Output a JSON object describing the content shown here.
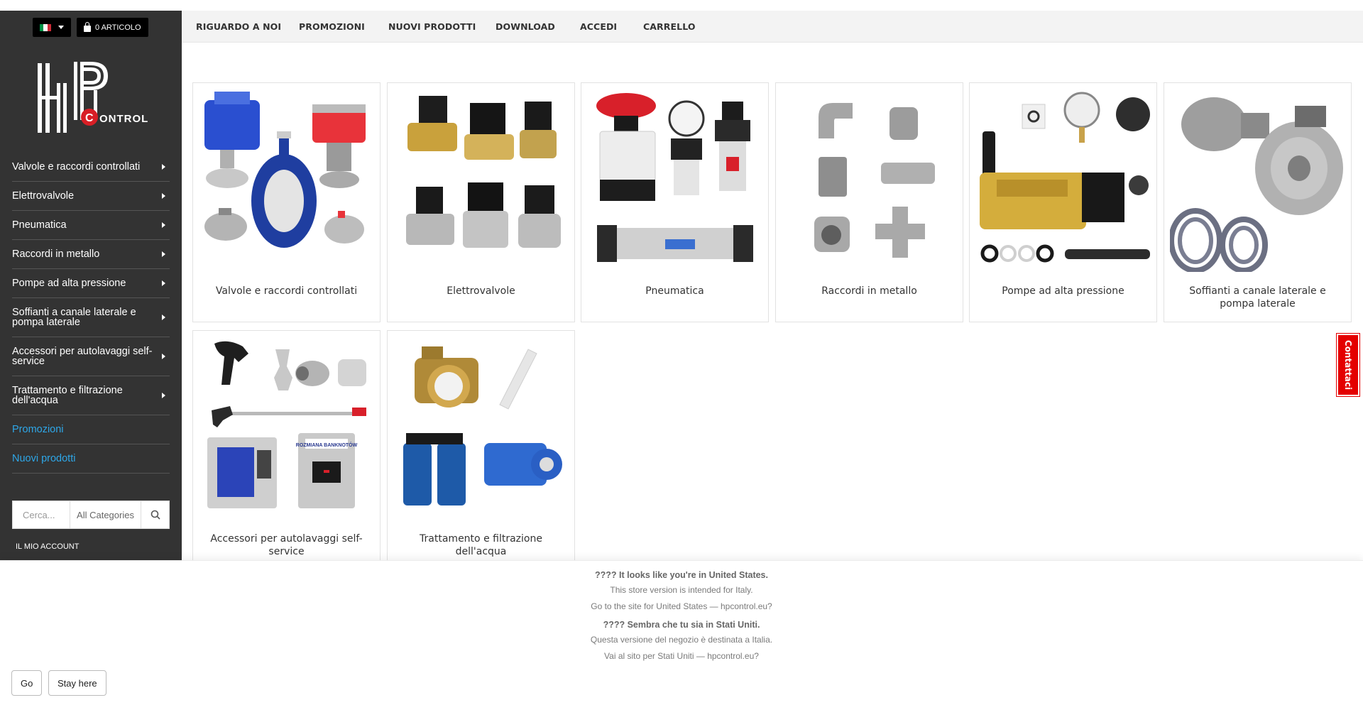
{
  "header": {
    "cart_label": "0 ARTICOLO",
    "nav": [
      {
        "label": "RIGUARDO A NOI"
      },
      {
        "label": "PROMOZIONI"
      },
      {
        "label": "NUOVI PRODOTTI"
      },
      {
        "label": "DOWNLOAD"
      },
      {
        "label": "ACCEDI"
      },
      {
        "label": "CARRELLO"
      }
    ]
  },
  "logo": {
    "text": "CONTROL"
  },
  "sidebar": {
    "items": [
      {
        "label": "Valvole e raccordi controllati",
        "arrow": true
      },
      {
        "label": "Elettrovalvole",
        "arrow": true
      },
      {
        "label": "Pneumatica",
        "arrow": true
      },
      {
        "label": "Raccordi in metallo",
        "arrow": true
      },
      {
        "label": "Pompe ad alta pressione",
        "arrow": true
      },
      {
        "label": "Soffianti a canale laterale e pompa laterale",
        "arrow": true
      },
      {
        "label": "Accessori per autolavaggi self-service",
        "arrow": true
      },
      {
        "label": "Trattamento e filtrazione dell'acqua",
        "arrow": true
      },
      {
        "label": "Promozioni",
        "arrow": false
      },
      {
        "label": "Nuovi prodotti",
        "arrow": false
      }
    ],
    "search_placeholder": "Cerca...",
    "category_select": "All Categories",
    "account_label": "IL MIO ACCOUNT"
  },
  "categories": [
    {
      "title": "Valvole e raccordi controllati"
    },
    {
      "title": "Elettrovalvole"
    },
    {
      "title": "Pneumatica"
    },
    {
      "title": "Raccordi in metallo"
    },
    {
      "title": "Pompe ad alta pressione"
    },
    {
      "title": "Soffianti a canale laterale e pompa laterale"
    },
    {
      "title": "Accessori per autolavaggi self-service"
    },
    {
      "title": "Trattamento e filtrazione dell'acqua"
    }
  ],
  "product_labels": {
    "banknote_machine": "ROZMIANA BANKNOTÓW"
  },
  "contact_tab": "Contattaci",
  "geo_banner": {
    "en_heading": "???? It looks like you're in United States.",
    "en_line1": "This store version is intended for Italy.",
    "en_line2": "Go to the site for United States — hpcontrol.eu?",
    "it_heading": "???? Sembra che tu sia in Stati Uniti.",
    "it_line1": "Questa versione del negozio è destinata a Italia.",
    "it_line2": "Vai al sito per Stati Uniti — hpcontrol.eu?",
    "go_label": "Go",
    "stay_label": "Stay here"
  },
  "colors": {
    "sidebar_bg": "#333333",
    "link_blue": "#2ea7e8",
    "contact_red": "#e40000",
    "logo_red": "#d81f26"
  }
}
